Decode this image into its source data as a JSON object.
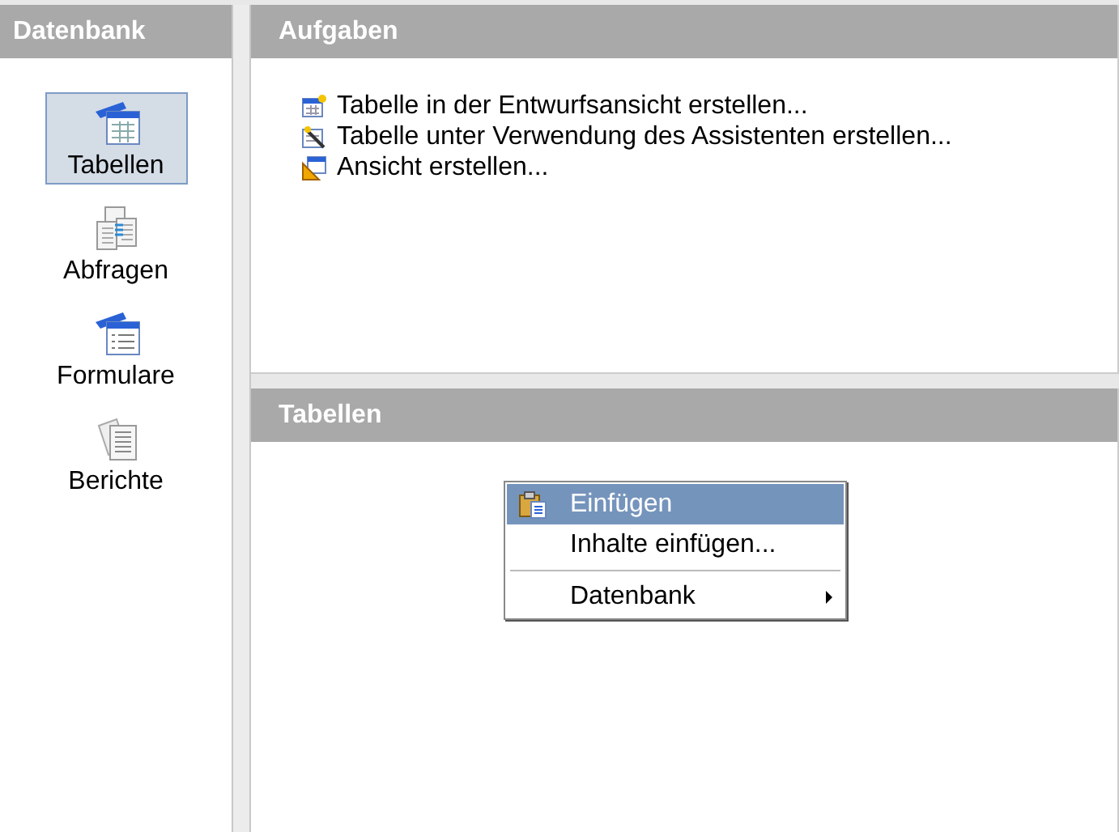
{
  "sidebar": {
    "title": "Datenbank",
    "items": [
      {
        "label": "Tabellen",
        "kind": "tables",
        "selected": true
      },
      {
        "label": "Abfragen",
        "kind": "queries",
        "selected": false
      },
      {
        "label": "Formulare",
        "kind": "forms",
        "selected": false
      },
      {
        "label": "Berichte",
        "kind": "reports",
        "selected": false
      }
    ]
  },
  "tasks": {
    "title": "Aufgaben",
    "items": [
      {
        "label": "Tabelle in der Entwurfsansicht erstellen...",
        "kind": "design"
      },
      {
        "label": "Tabelle unter Verwendung des Assistenten erstellen...",
        "kind": "wizard"
      },
      {
        "label": "Ansicht erstellen...",
        "kind": "view"
      }
    ]
  },
  "objects": {
    "title": "Tabellen"
  },
  "context_menu": {
    "items": [
      {
        "kind": "item",
        "label": "Einfügen",
        "icon": true,
        "selected": true
      },
      {
        "kind": "item",
        "label": "Inhalte einfügen...",
        "icon": false,
        "selected": false
      },
      {
        "kind": "separator"
      },
      {
        "kind": "submenu",
        "label": "Datenbank",
        "selected": false
      }
    ]
  }
}
